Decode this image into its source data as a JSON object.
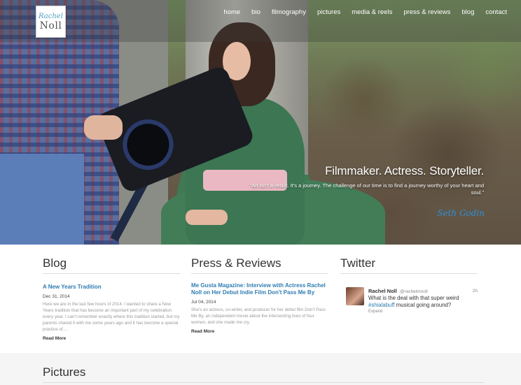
{
  "logo": {
    "line1": "Rachel",
    "line2": "Noll"
  },
  "nav": [
    "home",
    "bio",
    "filmography",
    "pictures",
    "media & reels",
    "press & reviews",
    "blog",
    "contact"
  ],
  "hero": {
    "tagline": "Filmmaker. Actress. Storyteller.",
    "quote": "“Art isn't a result. It's a journey. The challenge of our time is to find a journey worthy of your heart and soul.”",
    "signature": "Seth Godin"
  },
  "blog": {
    "heading": "Blog",
    "title": "A New Years Tradition",
    "date": "Dec 31, 2014",
    "excerpt": "Here we are in the last few hours of 2014. I wanted to share a New Years tradition that has become an important part of my celebration every year. I can't remember exactly where this tradition started, but my parents shared it with me some years ago and it has become a special practice of....",
    "read_more": "Read More"
  },
  "press": {
    "heading": "Press & Reviews",
    "title": "Me Gusta Magazine: Interview with Actress Rachel Noll on Her Debut Indie Film Don't Pass Me By",
    "date": "Jul 04, 2014",
    "excerpt": "She's an actress, co-writer, and producer for her debut film Don't Pass Me By, an independent movie about the intersecting lives of four women, and she made me cry.",
    "read_more": "Read More"
  },
  "twitter": {
    "heading": "Twitter",
    "name": "Rachel Noll",
    "handle": "@rachelmnoll",
    "time": "2h",
    "text_before": "What is the deal with that super weird ",
    "hashtag": "#shialabuff",
    "text_after": " musical going around?",
    "expand": "Expand"
  },
  "pictures": {
    "heading": "Pictures"
  }
}
